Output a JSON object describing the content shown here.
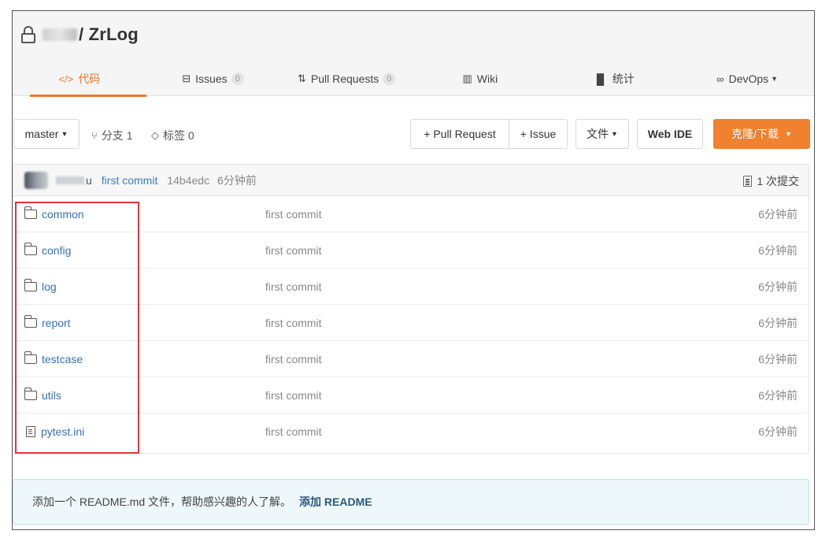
{
  "repo": {
    "name": "/ ZrLog"
  },
  "tabs": [
    {
      "label": "代码",
      "icon": "code-icon",
      "active": true
    },
    {
      "label": "Issues",
      "count": "0",
      "icon": "issues-icon"
    },
    {
      "label": "Pull Requests",
      "count": "0",
      "icon": "pull-request-icon"
    },
    {
      "label": "Wiki",
      "icon": "wiki-icon"
    },
    {
      "label": "统计",
      "icon": "chart-icon"
    },
    {
      "label": "DevOps",
      "icon": "infinity-icon"
    }
  ],
  "toolbar": {
    "branch": "master",
    "branches_label": "分支 1",
    "tags_label": "标签 0",
    "new_pr": "+ Pull Request",
    "new_issue": "+ Issue",
    "file_menu": "文件",
    "web_ide": "Web IDE",
    "clone": "克隆/下载"
  },
  "commit": {
    "author": "u",
    "message": "first commit",
    "sha": "14b4edc",
    "time": "6分钟前",
    "count": "1 次提交"
  },
  "files": [
    {
      "name": "common",
      "type": "folder",
      "message": "first commit",
      "age": "6分钟前"
    },
    {
      "name": "config",
      "type": "folder",
      "message": "first commit",
      "age": "6分钟前"
    },
    {
      "name": "log",
      "type": "folder",
      "message": "first commit",
      "age": "6分钟前"
    },
    {
      "name": "report",
      "type": "folder",
      "message": "first commit",
      "age": "6分钟前"
    },
    {
      "name": "testcase",
      "type": "folder",
      "message": "first commit",
      "age": "6分钟前"
    },
    {
      "name": "utils",
      "type": "folder",
      "message": "first commit",
      "age": "6分钟前"
    },
    {
      "name": "pytest.ini",
      "type": "file",
      "message": "first commit",
      "age": "6分钟前"
    }
  ],
  "readme": {
    "text": "添加一个 README.md 文件，帮助感兴趣的人了解。",
    "link": "添加 README"
  },
  "colors": {
    "accent": "#ec7a2d",
    "link": "#3a70b5",
    "highlight": "#e0333c"
  }
}
